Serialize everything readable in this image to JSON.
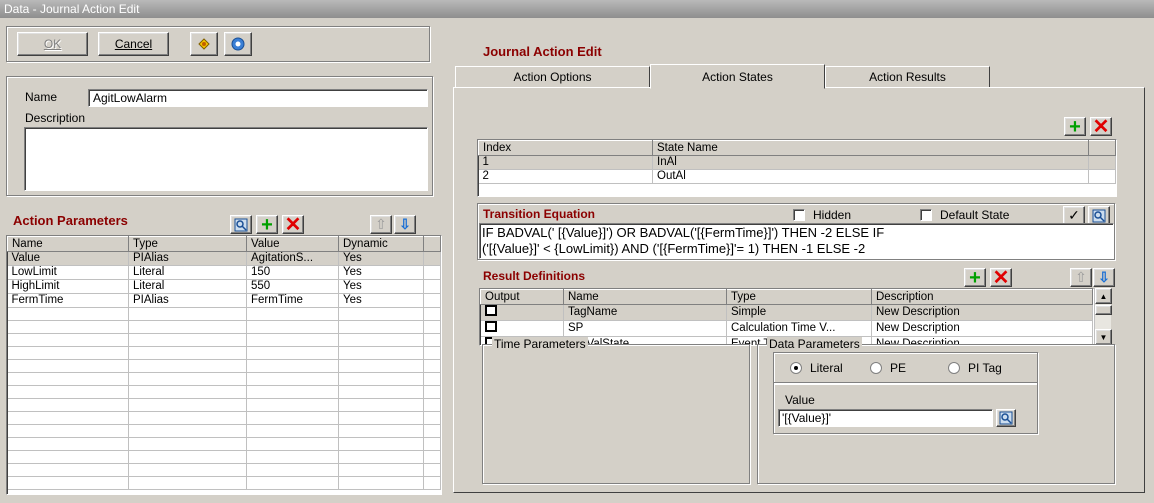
{
  "window": {
    "title": "Data - Journal Action Edit"
  },
  "toolbar": {
    "ok": "OK",
    "cancel": "Cancel"
  },
  "form": {
    "name_label": "Name",
    "name_value": "AgitLowAlarm",
    "description_label": "Description",
    "description_value": ""
  },
  "action_parameters": {
    "title": "Action Parameters",
    "columns": [
      "Name",
      "Type",
      "Value",
      "Dynamic"
    ],
    "rows": [
      [
        "Value",
        "PIAlias",
        "AgitationS...",
        "Yes"
      ],
      [
        "LowLimit",
        "Literal",
        "150",
        "Yes"
      ],
      [
        "HighLimit",
        "Literal",
        "550",
        "Yes"
      ],
      [
        "FermTime",
        "PIAlias",
        "FermTime",
        "Yes"
      ]
    ]
  },
  "main": {
    "title": "Journal Action Edit"
  },
  "tabs": [
    {
      "label": "Action Options"
    },
    {
      "label": "Action States"
    },
    {
      "label": "Action Results"
    }
  ],
  "states": {
    "columns": [
      "Index",
      "State Name"
    ],
    "rows": [
      [
        "1",
        "InAl"
      ],
      [
        "2",
        "OutAl"
      ]
    ]
  },
  "transition": {
    "title": "Transition Equation",
    "hidden_label": "Hidden",
    "default_state_label": "Default State",
    "line1": "IF BADVAL(' [{Value}]') OR BADVAL('[{FermTime}]') THEN -2 ELSE IF",
    "line2": "('[{Value}]' < {LowLimit}) AND ('[{FermTime}]'= 1) THEN -1 ELSE -2"
  },
  "results": {
    "title": "Result Definitions",
    "columns": [
      "Output",
      "Name",
      "Type",
      "Description"
    ],
    "rows": [
      [
        "",
        "TagName",
        "Simple",
        "New Description"
      ],
      [
        "",
        "SP",
        "Calculation Time V...",
        "New Description"
      ],
      [
        "",
        "TagValState",
        "Event Time Value",
        "New Description"
      ]
    ]
  },
  "time_parameters": {
    "title": "Time Parameters"
  },
  "data_parameters": {
    "title": "Data Parameters",
    "options": [
      "Literal",
      "PE",
      "PI Tag"
    ],
    "selected": "Literal",
    "value_label": "Value",
    "value": "'[{Value}]'"
  },
  "colors": {
    "accent_red": "#8b0000",
    "tab_bg": "#d4d0c8"
  }
}
